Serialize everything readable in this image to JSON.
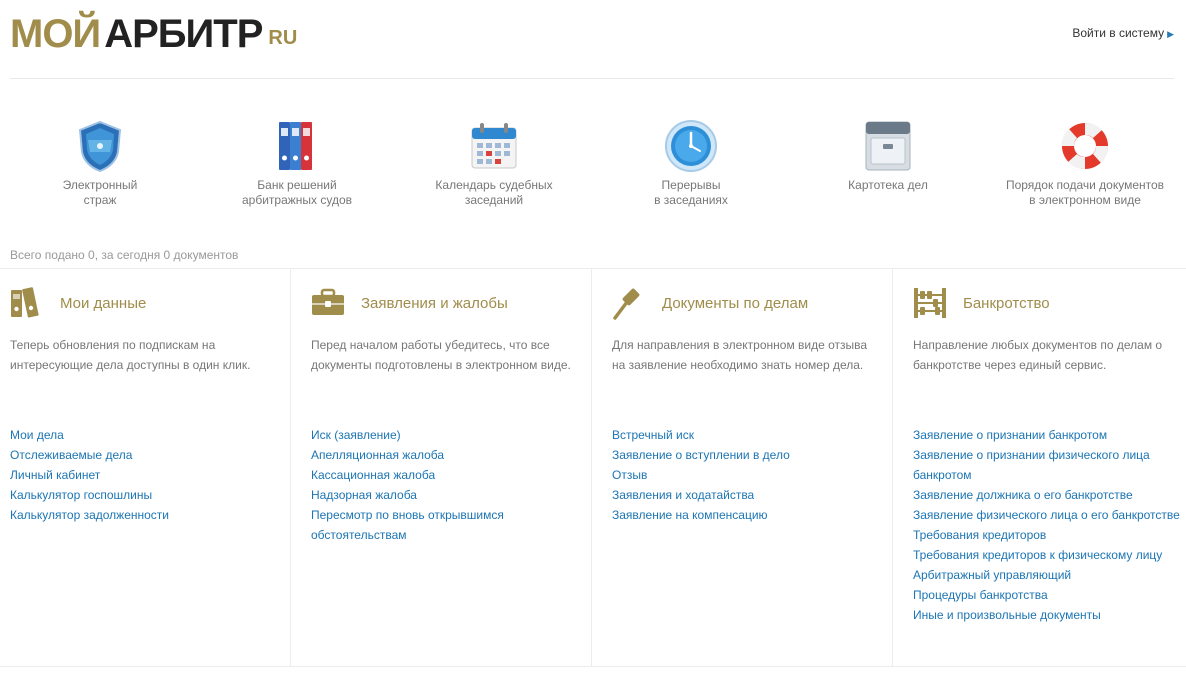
{
  "header": {
    "logo_part1": "МОЙ",
    "logo_part2": "АРБИТР",
    "logo_part3": "RU",
    "login_label": "Войти в систему"
  },
  "services": [
    {
      "label": "Электронный\nстраж",
      "icon": "shield-icon"
    },
    {
      "label": "Банк решений\nарбитражных судов",
      "icon": "binders-icon"
    },
    {
      "label": "Календарь судебных\nзаседаний",
      "icon": "calendar-icon"
    },
    {
      "label": "Перерывы\nв заседаниях",
      "icon": "clock-icon"
    },
    {
      "label": "Картотека дел",
      "icon": "file-cabinet-icon"
    },
    {
      "label": "Порядок подачи документов\nв электронном виде",
      "icon": "lifebuoy-icon"
    }
  ],
  "stats": "Всего подано 0, за сегодня 0 документов",
  "columns": [
    {
      "title": "Мои данные",
      "icon": "folders-icon",
      "desc": "Теперь обновления по подпискам на интересующие дела доступны в один клик.",
      "links": [
        "Мои дела",
        "Отслеживаемые дела",
        "Личный кабинет",
        "Калькулятор госпошлины",
        "Калькулятор задолженности"
      ]
    },
    {
      "title": "Заявления и жалобы",
      "icon": "briefcase-icon",
      "desc": "Перед началом работы убедитесь, что все документы подготовлены в электронном виде.",
      "links": [
        "Иск (заявление)",
        "Апелляционная жалоба",
        "Кассационная жалоба",
        "Надзорная жалоба",
        "Пересмотр по вновь открывшимся обстоятельствам"
      ]
    },
    {
      "title": "Документы по делам",
      "icon": "gavel-icon",
      "desc": "Для направления в электронном виде отзыва на заявление необходимо знать номер дела.",
      "links": [
        "Встречный иск",
        "Заявление о вступлении в дело",
        "Отзыв",
        "Заявления и ходатайства",
        "Заявление на компенсацию"
      ]
    },
    {
      "title": "Банкротство",
      "icon": "abacus-icon",
      "desc": "Направление любых документов по делам о банкротстве через единый сервис.",
      "links": [
        "Заявление о признании банкротом",
        "Заявление о признании физического лица банкротом",
        "Заявление должника о его банкротстве",
        "Заявление физического лица о его банкротстве",
        "Требования кредиторов",
        "Требования кредиторов к физическому лицу",
        "Арбитражный управляющий",
        "Процедуры банкротства",
        "Иные и произвольные документы"
      ]
    }
  ],
  "colors": {
    "accent": "#a08d4b",
    "link": "#1c75b3",
    "text": "#777777"
  }
}
